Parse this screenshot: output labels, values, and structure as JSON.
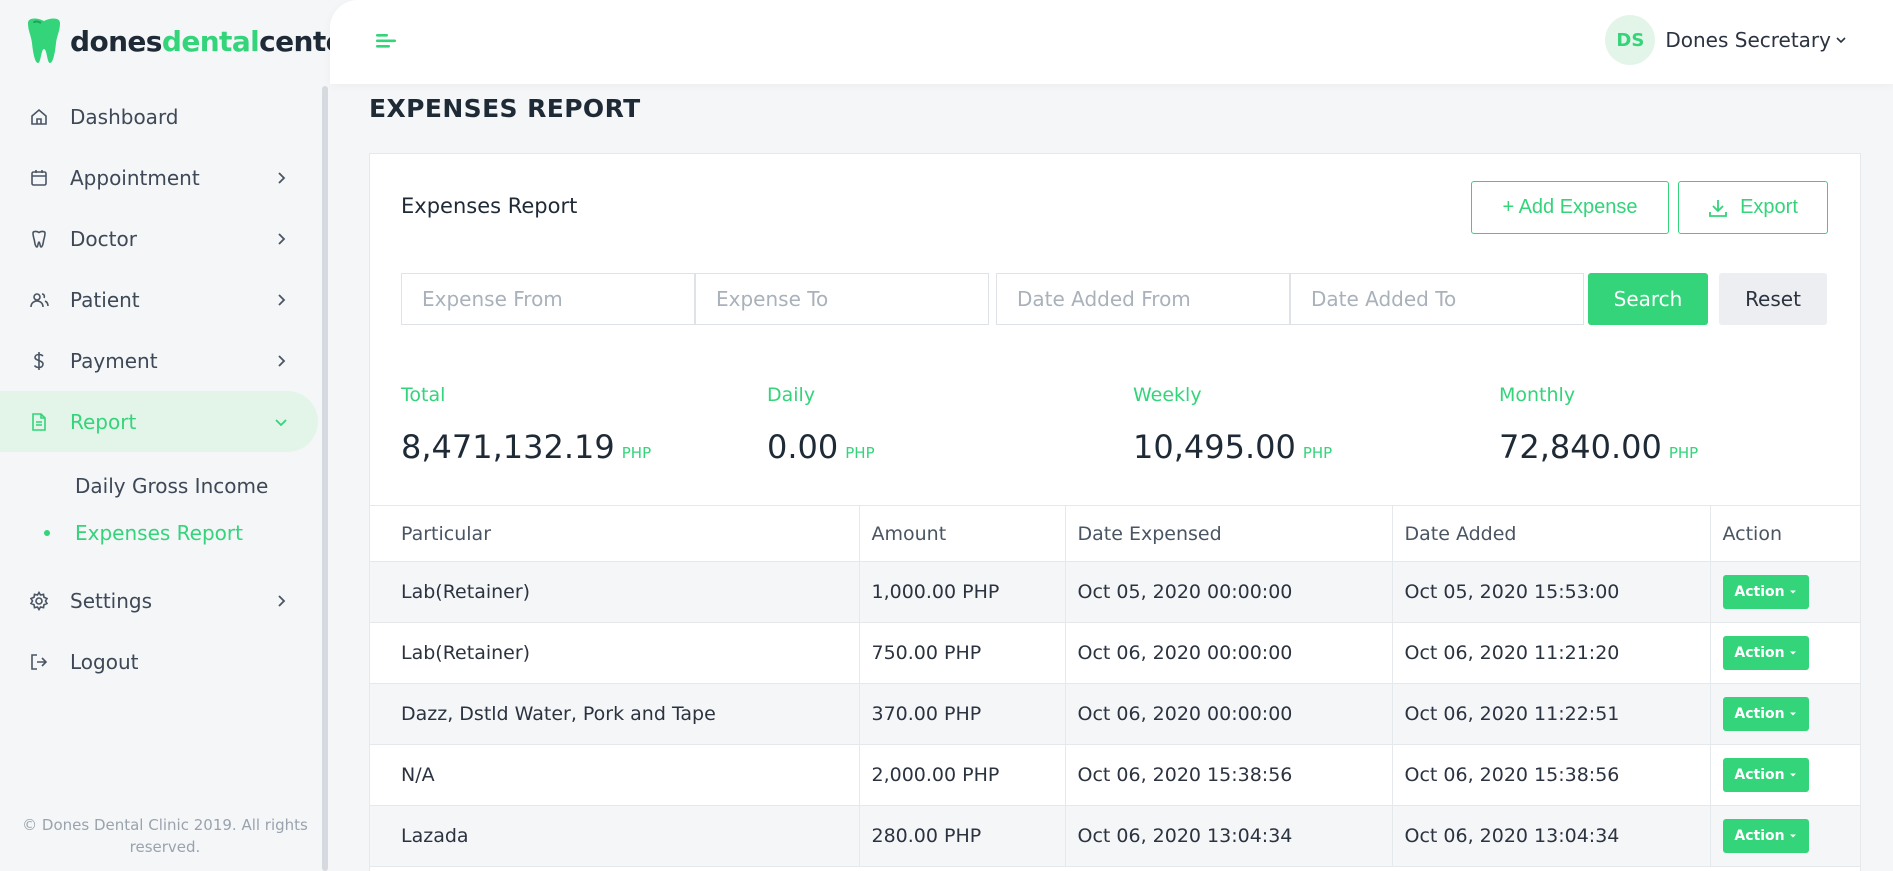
{
  "brand": {
    "part1": "dones",
    "part2": "dental",
    "part3": "center",
    "accent": "#33d47a"
  },
  "sidebar": {
    "items": [
      {
        "label": "Dashboard",
        "icon": "home-icon"
      },
      {
        "label": "Appointment",
        "icon": "calendar-icon"
      },
      {
        "label": "Doctor",
        "icon": "tooth-icon"
      },
      {
        "label": "Patient",
        "icon": "users-icon"
      },
      {
        "label": "Payment",
        "icon": "dollar-icon"
      },
      {
        "label": "Report",
        "icon": "document-icon"
      },
      {
        "label": "Settings",
        "icon": "gear-icon"
      },
      {
        "label": "Logout",
        "icon": "logout-icon"
      }
    ],
    "report_sub": [
      {
        "label": "Daily Gross Income"
      },
      {
        "label": "Expenses Report"
      }
    ],
    "footer": "© Dones Dental Clinic 2019. All rights reserved."
  },
  "topbar": {
    "avatar": "DS",
    "user_name": "Dones Secretary"
  },
  "page": {
    "title": "EXPENSES REPORT"
  },
  "card": {
    "title": "Expenses Report",
    "add_label": "+ Add Expense",
    "export_label": "Export"
  },
  "filters": {
    "expense_from": "Expense From",
    "expense_to": "Expense To",
    "date_from": "Date Added From",
    "date_to": "Date Added To",
    "search_label": "Search",
    "reset_label": "Reset"
  },
  "stats": [
    {
      "label": "Total",
      "value": "8,471,132.19",
      "unit": "PHP"
    },
    {
      "label": "Daily",
      "value": "0.00",
      "unit": "PHP"
    },
    {
      "label": "Weekly",
      "value": "10,495.00",
      "unit": "PHP"
    },
    {
      "label": "Monthly",
      "value": "72,840.00",
      "unit": "PHP"
    }
  ],
  "table": {
    "headers": [
      "Particular",
      "Amount",
      "Date Expensed",
      "Date Added",
      "Action"
    ],
    "action_label": "Action",
    "rows": [
      [
        "Lab(Retainer)",
        "1,000.00 PHP",
        "Oct 05, 2020 00:00:00",
        "Oct 05, 2020 15:53:00"
      ],
      [
        "Lab(Retainer)",
        "750.00 PHP",
        "Oct 06, 2020 00:00:00",
        "Oct 06, 2020 11:21:20"
      ],
      [
        "Dazz, Dstld Water, Pork and Tape",
        "370.00 PHP",
        "Oct 06, 2020 00:00:00",
        "Oct 06, 2020 11:22:51"
      ],
      [
        "N/A",
        "2,000.00 PHP",
        "Oct 06, 2020 15:38:56",
        "Oct 06, 2020 15:38:56"
      ],
      [
        "Lazada",
        "280.00 PHP",
        "Oct 06, 2020 13:04:34",
        "Oct 06, 2020 13:04:34"
      ]
    ]
  }
}
